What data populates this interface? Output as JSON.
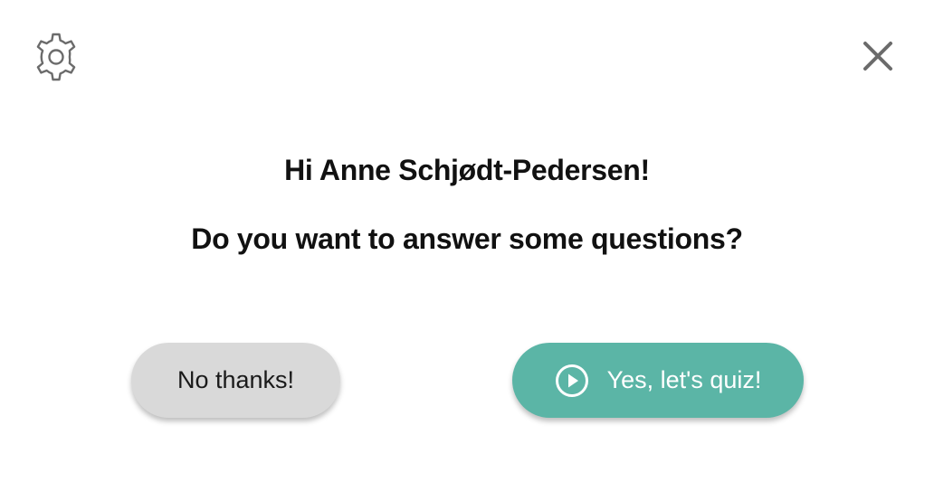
{
  "header": {
    "settings_icon": "gear-icon",
    "close_icon": "close-icon"
  },
  "prompt": {
    "greeting": "Hi Anne Schjødt-Pedersen!",
    "question": "Do you want to answer some questions?"
  },
  "actions": {
    "decline_label": "No thanks!",
    "accept_label": "Yes, let's quiz!",
    "accept_icon": "play-circle-icon"
  },
  "colors": {
    "accept_bg": "#5bb5a6",
    "decline_bg": "#d9d9d9",
    "icon_gray": "#6b6b6b"
  }
}
